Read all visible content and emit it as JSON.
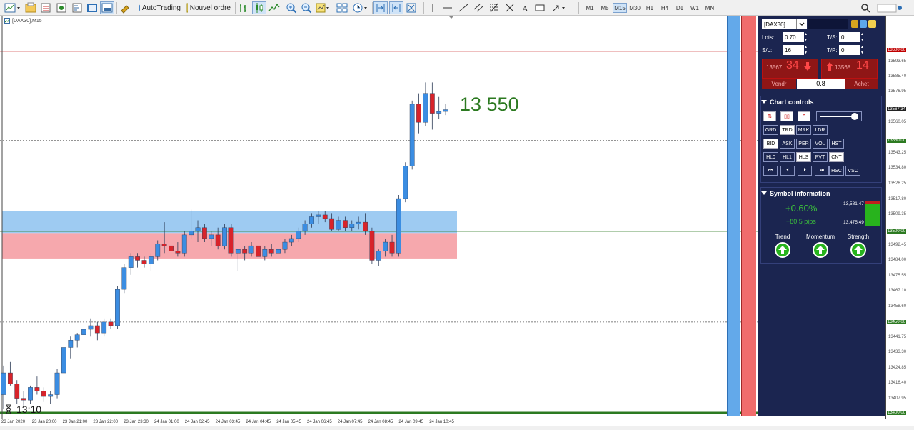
{
  "toolbar": {
    "autotrading_label": "AutoTrading",
    "new_order_label": "Nouvel ordre",
    "timeframes": [
      "M1",
      "M5",
      "M15",
      "M30",
      "H1",
      "H4",
      "D1",
      "W1",
      "MN"
    ],
    "active_timeframe": "M15"
  },
  "chart": {
    "title": "[DAX30],M15",
    "big_level": "13 550",
    "clock": "13:10",
    "price_labels": [
      "13593.65",
      "13585.40",
      "13576.95",
      "13560.05",
      "13543.25",
      "13534.80",
      "13526.25",
      "13517.80",
      "13509.35",
      "13492.45",
      "13484.00",
      "13475.55",
      "13467.10",
      "13458.60",
      "13441.75",
      "13433.30",
      "13424.85",
      "13416.40",
      "13407.95",
      "13391.05"
    ],
    "badges": {
      "top": "13600.00",
      "current": "13567.34",
      "level_13550": "13550.00",
      "level_13500": "13500.00",
      "level_13450": "13450.00",
      "level_13400": "13400.00"
    },
    "time_labels": [
      "23 Jan 2020",
      "23 Jan 20:00",
      "23 Jan 21:00",
      "23 Jan 22:00",
      "23 Jan 23:30",
      "24 Jan 01:00",
      "24 Jan 02:45",
      "24 Jan 03:45",
      "24 Jan 04:45",
      "24 Jan 05:45",
      "24 Jan 06:45",
      "24 Jan 07:45",
      "24 Jan 08:45",
      "24 Jan 09:45",
      "24 Jan 10:45"
    ],
    "colors": {
      "bull": "#3b8de2",
      "bear": "#d8232a",
      "level_green": "#2c7a21",
      "level_red": "#c00000",
      "zone_blue": "#9ecbf2",
      "zone_red": "#f6a8ad"
    }
  },
  "panel": {
    "symbol": "[DAX30]",
    "lots_label": "Lots:",
    "lots_value": "0.70",
    "ts_label": "T/S:",
    "ts_value": "0",
    "sl_label": "S/L:",
    "sl_value": "16",
    "tp_label": "T/P:",
    "tp_value": "0",
    "sell_prefix": "13567.",
    "sell_big": "34",
    "sell_label": "Vendr",
    "buy_prefix": "13568.",
    "buy_big": "14",
    "buy_label": "Achet",
    "spread": "0.8",
    "chart_controls_title": "Chart controls",
    "control_rows": [
      [
        "GRD",
        "TRD",
        "MRK",
        "LDR"
      ],
      [
        "BID",
        "ASK",
        "PER",
        "VOL",
        "HST"
      ],
      [
        "HL0",
        "HL1",
        "HLS",
        "PVT",
        "CNT"
      ],
      [
        "HSC",
        "VSC"
      ]
    ],
    "symbol_info_title": "Symbol information",
    "change_percent": "+0.60%",
    "change_pips": "+80.5 pips",
    "range_high": "13,581.47",
    "range_low": "13,475.49",
    "range_fraction": 0.86,
    "indicators": [
      {
        "label": "Trend",
        "icon": "arrow-up-icon"
      },
      {
        "label": "Momentum",
        "icon": "arrow-up-icon"
      },
      {
        "label": "Strength",
        "icon": "arrow-up-icon"
      }
    ]
  },
  "candles": [
    [
      13410,
      13426,
      13402,
      13422
    ],
    [
      13422,
      13428,
      13415,
      13416
    ],
    [
      13416,
      13418,
      13405,
      13408
    ],
    [
      13408,
      13412,
      13404,
      13407
    ],
    [
      13407,
      13415,
      13405,
      13414
    ],
    [
      13414,
      13420,
      13410,
      13412
    ],
    [
      13412,
      13414,
      13406,
      13409
    ],
    [
      13409,
      13412,
      13405,
      13410
    ],
    [
      13410,
      13424,
      13408,
      13422
    ],
    [
      13422,
      13438,
      13420,
      13436
    ],
    [
      13436,
      13442,
      13430,
      13440
    ],
    [
      13440,
      13444,
      13436,
      13443
    ],
    [
      13443,
      13448,
      13438,
      13446
    ],
    [
      13446,
      13452,
      13442,
      13448
    ],
    [
      13448,
      13450,
      13440,
      13444
    ],
    [
      13444,
      13452,
      13442,
      13450
    ],
    [
      13450,
      13452,
      13446,
      13448
    ],
    [
      13448,
      13470,
      13446,
      13468
    ],
    [
      13468,
      13482,
      13466,
      13480
    ],
    [
      13480,
      13488,
      13476,
      13486
    ],
    [
      13486,
      13488,
      13480,
      13484
    ],
    [
      13484,
      13486,
      13480,
      13482
    ],
    [
      13482,
      13488,
      13478,
      13486
    ],
    [
      13486,
      13495,
      13484,
      13493
    ],
    [
      13493,
      13505,
      13488,
      13492
    ],
    [
      13492,
      13498,
      13486,
      13489
    ],
    [
      13489,
      13494,
      13486,
      13488
    ],
    [
      13488,
      13500,
      13486,
      13498
    ],
    [
      13498,
      13512,
      13496,
      13500
    ],
    [
      13500,
      13506,
      13494,
      13502
    ],
    [
      13502,
      13504,
      13494,
      13496
    ],
    [
      13496,
      13500,
      13492,
      13498
    ],
    [
      13498,
      13502,
      13490,
      13492
    ],
    [
      13492,
      13504,
      13490,
      13502
    ],
    [
      13502,
      13504,
      13486,
      13488
    ],
    [
      13488,
      13490,
      13478,
      13490
    ],
    [
      13490,
      13492,
      13484,
      13488
    ],
    [
      13488,
      13494,
      13486,
      13492
    ],
    [
      13492,
      13494,
      13484,
      13486
    ],
    [
      13486,
      13492,
      13484,
      13490
    ],
    [
      13490,
      13493,
      13486,
      13488
    ],
    [
      13488,
      13492,
      13484,
      13490
    ],
    [
      13490,
      13496,
      13488,
      13494
    ],
    [
      13494,
      13498,
      13492,
      13496
    ],
    [
      13496,
      13502,
      13494,
      13500
    ],
    [
      13500,
      13506,
      13498,
      13504
    ],
    [
      13504,
      13510,
      13502,
      13508
    ],
    [
      13508,
      13511,
      13504,
      13509
    ],
    [
      13509,
      13511,
      13505,
      13507
    ],
    [
      13507,
      13510,
      13500,
      13501
    ],
    [
      13501,
      13508,
      13500,
      13506
    ],
    [
      13506,
      13508,
      13500,
      13502
    ],
    [
      13502,
      13506,
      13500,
      13504
    ],
    [
      13504,
      13508,
      13501,
      13505
    ],
    [
      13505,
      13510,
      13498,
      13500
    ],
    [
      13500,
      13502,
      13482,
      13484
    ],
    [
      13484,
      13490,
      13481,
      13489
    ],
    [
      13489,
      13496,
      13486,
      13494
    ],
    [
      13494,
      13498,
      13486,
      13488
    ],
    [
      13488,
      13520,
      13486,
      13518
    ],
    [
      13518,
      13538,
      13516,
      13536
    ],
    [
      13536,
      13572,
      13534,
      13570
    ],
    [
      13570,
      13576,
      13554,
      13560
    ],
    [
      13560,
      13582,
      13558,
      13576
    ],
    [
      13576,
      13582,
      13556,
      13565
    ],
    [
      13565,
      13574,
      13562,
      13566
    ],
    [
      13566,
      13570,
      13564,
      13567
    ]
  ]
}
